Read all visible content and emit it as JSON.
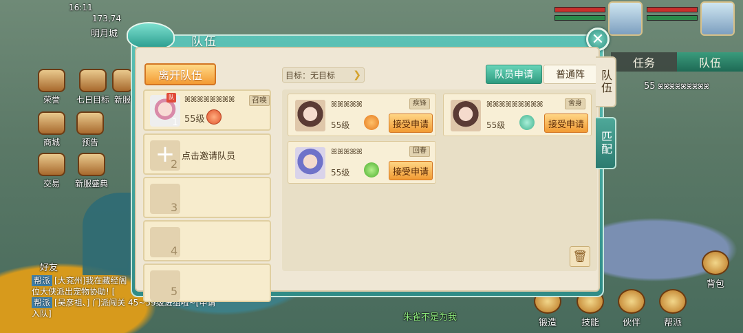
{
  "hud": {
    "time": "16:11",
    "coords": "173,74",
    "location": "明月城",
    "left_menu": [
      "荣誉",
      "七日目标",
      "新服",
      "商城",
      "预告",
      "交易",
      "新服盛典"
    ],
    "friends": "好友",
    "right_tabs": {
      "task": "任务",
      "team": "队伍"
    },
    "team_member_level": "55",
    "team_member_name": "ꕤꕤꕤꕤꕤꕤꕤꕤꕤ",
    "bottom_buttons": [
      "锻造",
      "技能",
      "伙伴",
      "帮派",
      "背包"
    ],
    "chat": [
      {
        "tag": "帮派",
        "text": "[大兖州]我在藏经阁"
      },
      {
        "tag": "",
        "text": "位大侠派出宠物协助! ["
      },
      {
        "tag": "帮派",
        "text": "[吴彦祖、] 门派闯关 45~59级进组啦~[申请"
      },
      {
        "tag": "",
        "text": "入队]"
      }
    ],
    "center_text": "朱雀不是为我"
  },
  "dialog": {
    "title": "队伍",
    "close_icon": "close-icon",
    "leave_label": "离开队伍",
    "target_label": "目标：无目标",
    "tabs": {
      "apply": "队员申请",
      "normal": "普通阵"
    },
    "side_tabs": {
      "team": "队伍",
      "match": "匹配"
    },
    "members": [
      {
        "slot": "1",
        "name": "ꕤꕤꕤꕤꕤꕤꕤꕤ",
        "level": "55级",
        "summon": "召唤",
        "captain": "队"
      }
    ],
    "invite_label": "点击邀请队员",
    "empty_slots": [
      "2",
      "3",
      "4",
      "5"
    ],
    "requests": [
      {
        "name": "ꕤꕤꕤꕤꕤ",
        "level": "55级",
        "school": "疾锋",
        "accept": "接受申请",
        "color": "#e4791d"
      },
      {
        "name": "ꕤꕤꕤꕤꕤꕤꕤꕤꕤ",
        "level": "55级",
        "school": "舍身",
        "accept": "接受申请",
        "color": "#3fb18c"
      },
      {
        "name": "ꕤꕤꕤꕤꕤ",
        "level": "55级",
        "school": "回春",
        "accept": "接受申请",
        "color": "#4aad2c"
      }
    ],
    "trash_icon": "trash-icon"
  },
  "colors": {
    "accent_teal": "#2f9b80",
    "button_orange": "#f39a33",
    "panel_bg": "#efe7d5"
  }
}
